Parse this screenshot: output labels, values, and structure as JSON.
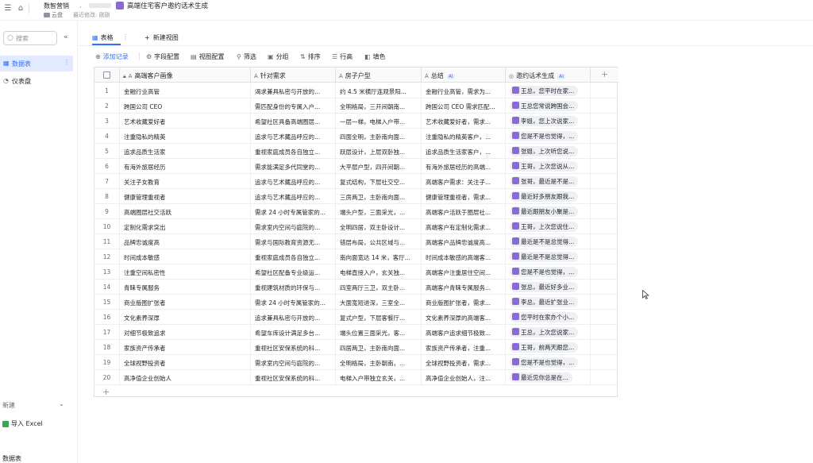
{
  "topbar": {
    "breadcrumb": "数智营销",
    "title": "高端住宅客户邀约话术生成",
    "folder": "云盘",
    "last_modified": "最近修改: 刚刚"
  },
  "sidebar": {
    "search_placeholder": "搜索",
    "items": [
      {
        "label": "数据表",
        "active": true
      },
      {
        "label": "仪表盘",
        "active": false
      }
    ],
    "new_label": "新建",
    "import_excel": "导入 Excel",
    "last_item": "数据表"
  },
  "tabs": {
    "table": "表格",
    "new_view": "新建视图"
  },
  "toolbar": {
    "add_record": "添加记录",
    "field_config": "字段配置",
    "view_config": "视图配置",
    "filter": "筛选",
    "group": "分组",
    "sort": "排序",
    "row_height": "行高",
    "fill": "填色"
  },
  "columns": [
    {
      "label": "高端客户画像"
    },
    {
      "label": "针对需求"
    },
    {
      "label": "房子户型"
    },
    {
      "label": "总结",
      "ai": "AI"
    },
    {
      "label": "邀约话术生成",
      "ai": "AI"
    }
  ],
  "rows": [
    {
      "n": "1",
      "c1": "金融行业高管",
      "c2": "渴求兼具私密与开放的...",
      "c3": "约 4.5 米横厅连观景阳...",
      "c4": "金融行业高管，需求为...",
      "c5": "王总，您平时在家..."
    },
    {
      "n": "2",
      "c1": "跨国公司 CEO",
      "c2": "需匹配身份的专属入户...",
      "c3": "全明格局，三开间朝南...",
      "c4": "跨国公司 CEO 需求匹配...",
      "c5": "王总您常说跨国会..."
    },
    {
      "n": "3",
      "c1": "艺术收藏爱好者",
      "c2": "希望社区具备高端圈层...",
      "c3": "一层一梯，电梯入户带...",
      "c4": "艺术收藏爱好者，需求...",
      "c5": "李姐，您上次说家..."
    },
    {
      "n": "4",
      "c1": "注重隐私的精英",
      "c2": "追求与艺术藏品呼应的...",
      "c3": "四面全明，主卧南向面...",
      "c4": "注重隐私的精英客户，...",
      "c5": "您是不是也觉得，..."
    },
    {
      "n": "5",
      "c1": "追求品质生活家",
      "c2": "重视家庭成员各自独立...",
      "c3": "跃层设计，上层双卧独...",
      "c4": "追求品质生活家客户，...",
      "c5": "张姐，上次听您说..."
    },
    {
      "n": "6",
      "c1": "有海外旅居经历",
      "c2": "需求能满足多代同堂的...",
      "c3": "大平层户型，四开间朝...",
      "c4": "有海外旅居经历的高端...",
      "c5": "王哥，上次您说从..."
    },
    {
      "n": "7",
      "c1": "关注子女教育",
      "c2": "追求与艺术藏品呼应的...",
      "c3": "复式结构，下层社交空...",
      "c4": "高端客户需求：关注子...",
      "c5": "张哥，最近是不是..."
    },
    {
      "n": "8",
      "c1": "健康管理重视者",
      "c2": "追求与艺术藏品呼应的...",
      "c3": "三房两卫，主卧南向面...",
      "c4": "健康管理重视者，需求...",
      "c5": "最近好多朋友跟我..."
    },
    {
      "n": "9",
      "c1": "高端圈层社交活跃",
      "c2": "需求 24 小时专属管家的...",
      "c3": "端头户型，三面采光，...",
      "c4": "高端客户活跃于圈层社...",
      "c5": "最近跟朋友小聚是..."
    },
    {
      "n": "10",
      "c1": "定制化需求突出",
      "c2": "需求室内空间与庭院的...",
      "c3": "全明四居，双主卧设计...",
      "c4": "高端客户有定制化需求...",
      "c5": "王哥，上次您说住..."
    },
    {
      "n": "11",
      "c1": "品牌忠诚度高",
      "c2": "需求与国际教育资源无...",
      "c3": "错层布局，公共区域与...",
      "c4": "高端客户品牌忠诚度高...",
      "c5": "最近是不是总觉得..."
    },
    {
      "n": "12",
      "c1": "时间成本敏感",
      "c2": "重视家庭成员各自独立...",
      "c3": "南向面宽达 14 米，客厅...",
      "c4": "时间成本敏感的高端客...",
      "c5": "最近是不是总觉得..."
    },
    {
      "n": "13",
      "c1": "注重空间私密性",
      "c2": "希望社区配备专业级运...",
      "c3": "电梯直接入户，玄关独...",
      "c4": "高端客户注重居住空间...",
      "c5": "您是不是也觉得，..."
    },
    {
      "n": "14",
      "c1": "青睐专属服务",
      "c2": "重视建筑材质的环保与...",
      "c3": "四室两厅三卫，双主卧...",
      "c4": "高端客户青睐专属服务...",
      "c5": "张总，最近好多业..."
    },
    {
      "n": "15",
      "c1": "商业版图扩张者",
      "c2": "需求 24 小时专属管家的...",
      "c3": "大面宽短进深，三室全...",
      "c4": "商业版图扩张者，需求...",
      "c5": "李总，最近扩张业..."
    },
    {
      "n": "16",
      "c1": "文化素养深厚",
      "c2": "追求兼具私密与开放的...",
      "c3": "复式户型，下层客餐厅...",
      "c4": "文化素养深厚的高端客...",
      "c5": "您平时在家办个小..."
    },
    {
      "n": "17",
      "c1": "对细节极致追求",
      "c2": "希望车库设计满足多台...",
      "c3": "端头位置三面采光，客...",
      "c4": "高端客户追求细节极致...",
      "c5": "王总，上次您说家..."
    },
    {
      "n": "18",
      "c1": "家族资产传承者",
      "c2": "重视社区安保系统的科...",
      "c3": "四居两卫，主卧南向面...",
      "c4": "家族资产传承者，注重...",
      "c5": "王哥，前两天跟您..."
    },
    {
      "n": "19",
      "c1": "全球视野投资者",
      "c2": "需求室内空间与庭院的...",
      "c3": "全明格局，主卧朝南，...",
      "c4": "全球视野投资者，需求...",
      "c5": "您是不是也觉得，..."
    },
    {
      "n": "20",
      "c1": "高净值企业创始人",
      "c2": "重视社区安保系统的科...",
      "c3": "电梯入户带独立玄关，...",
      "c4": "高净值企业创始人，注...",
      "c5": "最近见你总是在..."
    }
  ]
}
